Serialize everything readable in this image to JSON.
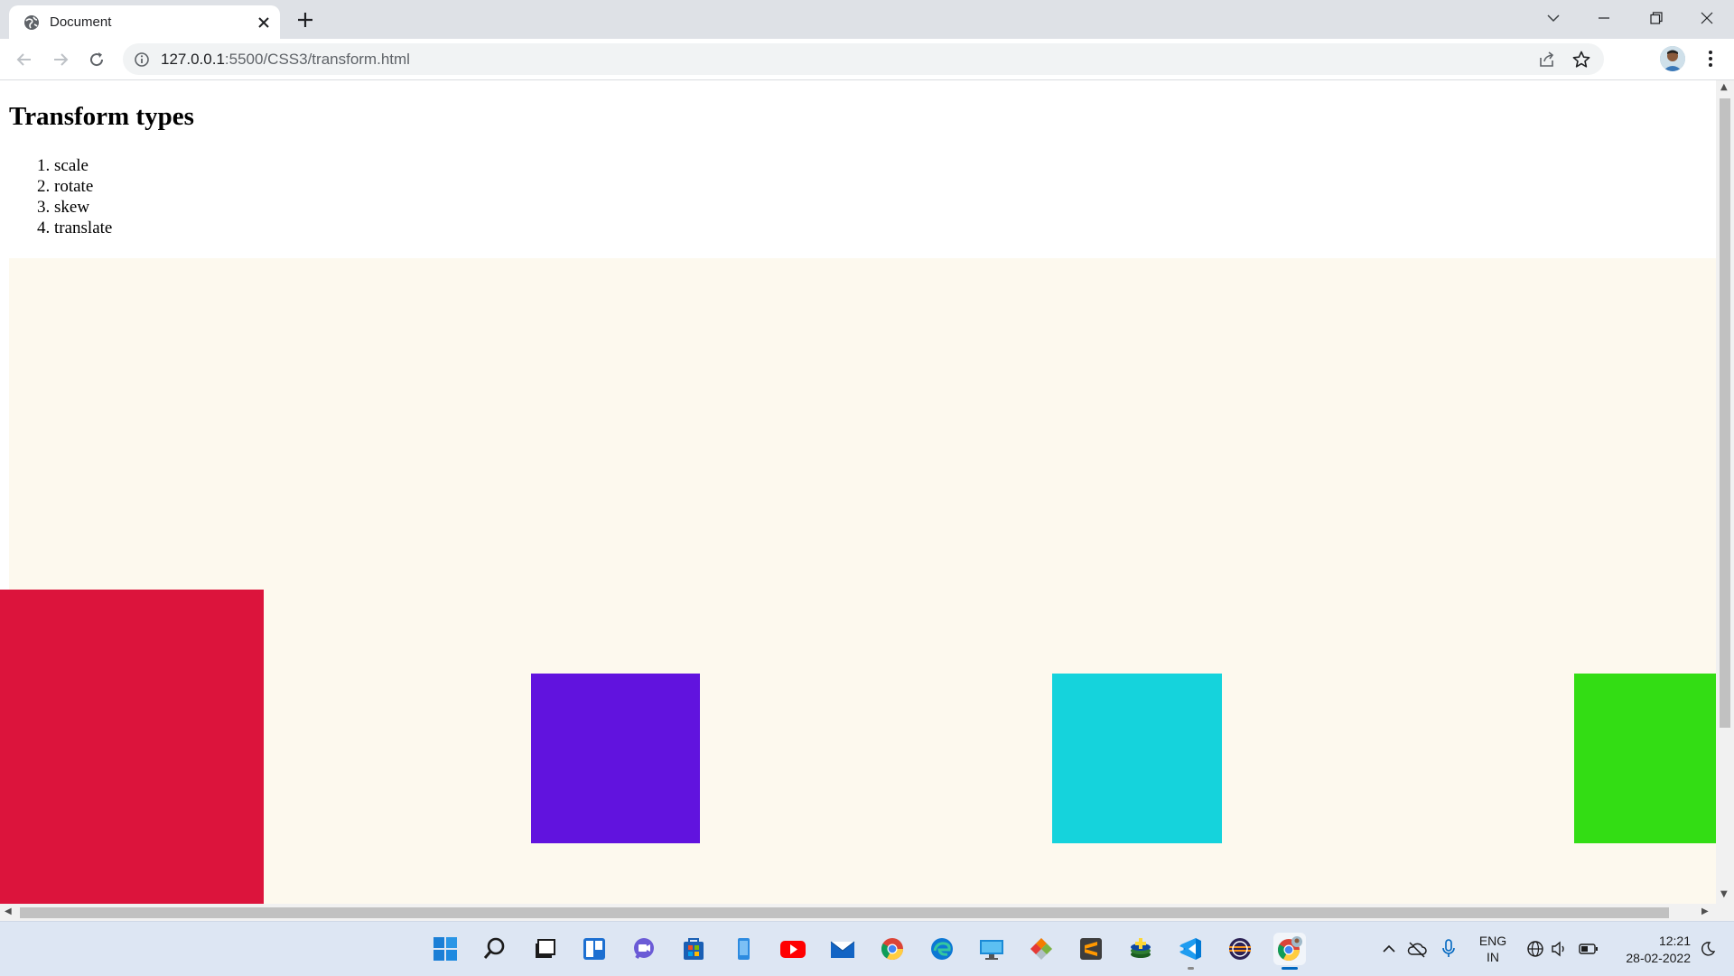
{
  "browser": {
    "tab_title": "Document",
    "url_host": "127.0.0.1",
    "url_rest": ":5500/CSS3/transform.html"
  },
  "page": {
    "heading": "Transform types",
    "types": [
      "scale",
      "rotate",
      "skew",
      "translate"
    ],
    "demo_background": "#fdf9ee",
    "boxes": [
      {
        "name": "scaled-box",
        "color": "#dc143c"
      },
      {
        "name": "rotate-box",
        "color": "#6113de"
      },
      {
        "name": "skew-box",
        "color": "#15d3dc"
      },
      {
        "name": "translate-box",
        "color": "#33dd14"
      }
    ]
  },
  "taskbar": {
    "language_top": "ENG",
    "language_bottom": "IN",
    "time": "12:21",
    "date": "28-02-2022"
  }
}
